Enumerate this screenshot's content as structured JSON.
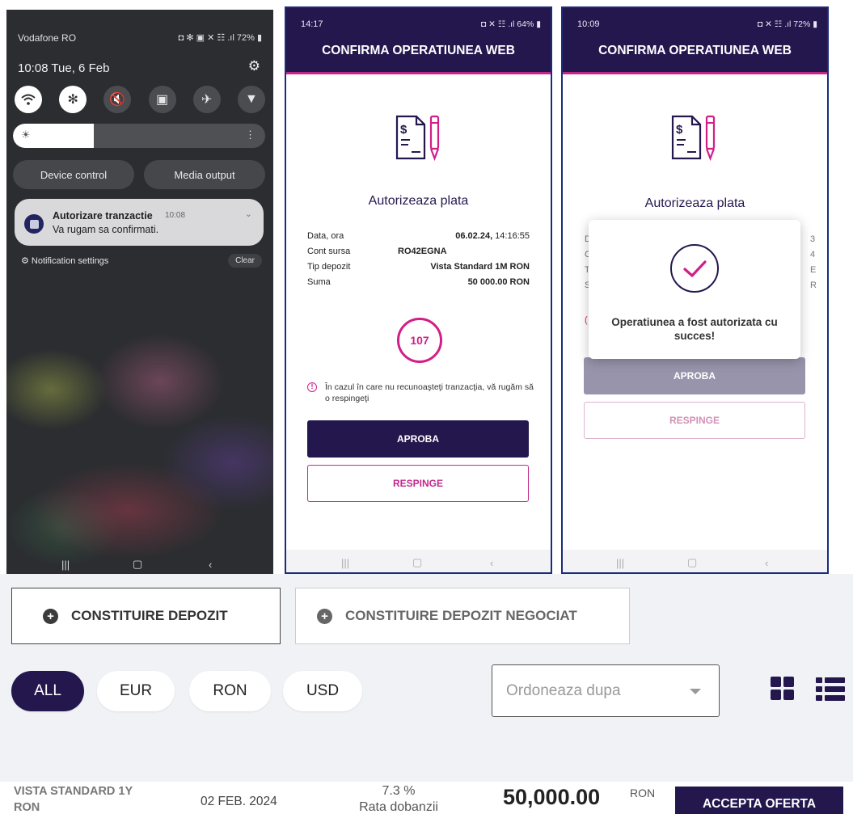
{
  "phone1": {
    "carrier": "Vodafone RO",
    "status_right": "◘ ✻ ▣ ✕ ☷ .ıl 72% ▮",
    "datetime": "10:08 Tue, 6 Feb",
    "device_control": "Device control",
    "media_output": "Media output",
    "notification": {
      "title": "Autorizare tranzactie",
      "time": "10:08",
      "text": "Va rugam sa confirmati."
    },
    "notification_settings": "Notification settings",
    "clear": "Clear",
    "brightness_level": 0.32
  },
  "phone2": {
    "time": "14:17",
    "status_right": "◘ ✕ ☷ .ıl 64% ▮",
    "app_title": "CONFIRMA OPERATIUNEA WEB",
    "auth_title": "Autorizeaza plata",
    "details": [
      {
        "label": "Data, ora",
        "value_bold": "06.02.24,",
        "value_rest": " 14:16:55"
      },
      {
        "label": "Cont sursa",
        "value": "RO42EGNA"
      },
      {
        "label": "Tip depozit",
        "value": "Vista Standard 1M RON"
      },
      {
        "label": "Suma",
        "value": "50 000.00 RON"
      }
    ],
    "countdown": "107",
    "warning": "În cazul în care nu recunoaşteţi tranzacţia, vă rugăm să o respingeţi",
    "approve": "APROBA",
    "reject": "RESPINGE"
  },
  "phone3": {
    "time": "10:09",
    "status_right": "◘ ✕ ☷ .ıl 72% ▮",
    "app_title": "CONFIRMA OPERATIUNEA WEB",
    "auth_title": "Autorizeaza plata",
    "success_message": "Operatiunea a fost autorizata cu succes!",
    "approve": "APROBA",
    "reject": "RESPINGE",
    "peek_left": [
      "D",
      "C",
      "T",
      "S"
    ],
    "peek_right": [
      "3",
      "4",
      "E",
      "R"
    ]
  },
  "web": {
    "btn_deposit": "CONSTITUIRE DEPOZIT",
    "btn_negotiated": "CONSTITUIRE DEPOZIT NEGOCIAT",
    "filters": [
      "ALL",
      "EUR",
      "RON",
      "USD"
    ],
    "active_filter": "ALL",
    "sort_placeholder": "Ordoneaza dupa",
    "offer": {
      "name": "VISTA STANDARD 1Y RON",
      "date": "02 FEB. 2024",
      "rate": "7.3 %",
      "rate_label": "Rata dobanzii",
      "amount": "50,000.00",
      "currency": "RON",
      "accept": "ACCEPTA OFERTA"
    }
  },
  "colors": {
    "brand_dark": "#24174e",
    "accent": "#c2288b",
    "timer": "#d21f87"
  }
}
